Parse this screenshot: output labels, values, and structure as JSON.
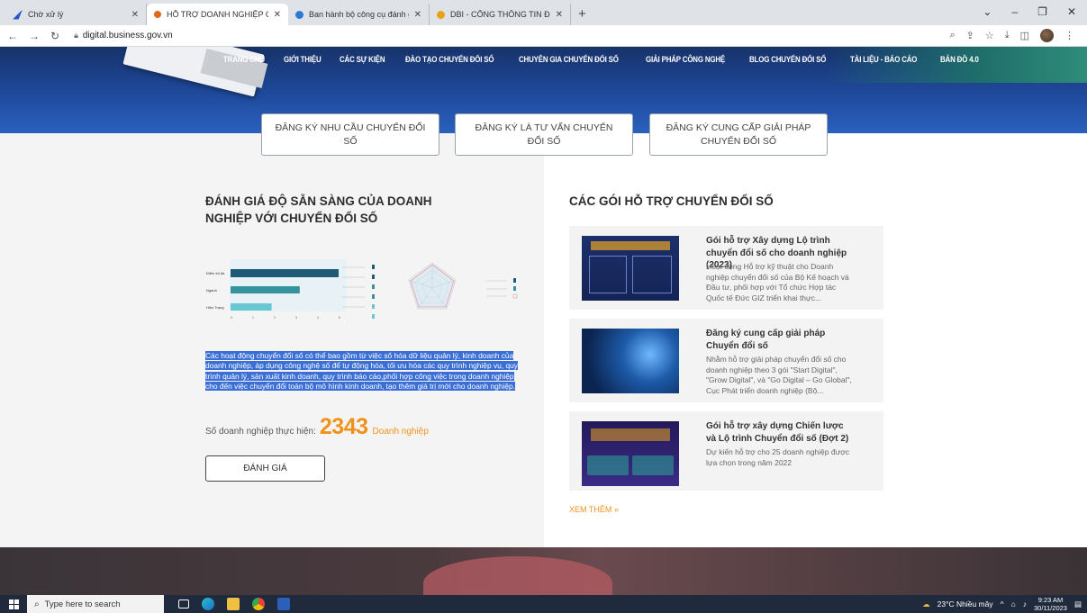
{
  "browser": {
    "tabs": [
      {
        "title": "Chờ xử lý",
        "favicon_color": "#2b57c7",
        "active": false
      },
      {
        "title": "HỖ TRỢ DOANH NGHIỆP CHUY",
        "favicon_color": "#e06a1b",
        "active": true
      },
      {
        "title": "Ban hành bộ công cụ đánh giá",
        "favicon_color": "#2b7bd6",
        "active": false
      },
      {
        "title": "DBI - CỔNG THÔNG TIN ĐÁNH",
        "favicon_color": "#e8a21a",
        "active": false
      }
    ],
    "url": "digital.business.gov.vn"
  },
  "site": {
    "nav": [
      "TRANG CHỦ",
      "GIỚI THIỆU",
      "CÁC SỰ KIỆN",
      "ĐÀO TẠO CHUYỂN ĐỔI SỐ",
      "CHUYÊN GIA CHUYỂN ĐỔI SỐ",
      "GIẢI PHÁP CÔNG NGHỆ",
      "BLOG CHUYỂN ĐỔI SỐ",
      "TÀI LIỆU - BÁO CÁO",
      "BẢN ĐỒ 4.0"
    ],
    "register_buttons": [
      "ĐĂNG KÝ NHU CẦU CHUYỂN ĐỔI SỐ",
      "ĐĂNG KÝ LÀ TƯ VẤN CHUYỂN ĐỔI SỐ",
      "ĐĂNG KÝ CUNG CẤP GIẢI PHÁP CHUYỂN ĐỔI SỐ"
    ],
    "assessment": {
      "title": "ĐÁNH GIÁ ĐỘ SẴN SÀNG CỦA DOANH NGHIỆP VỚI CHUYỂN ĐỔI SỐ",
      "bar_labels": [
        "Điểm tối đa",
        "Ngành",
        "Hiện Trạng"
      ],
      "bar_values": [
        5,
        3.2,
        1.9
      ],
      "axis_ticks": [
        "0",
        "1",
        "2",
        "3",
        "4",
        "5"
      ],
      "description": "Các hoạt động chuyển đổi số có thể bao gồm từ việc số hóa dữ liệu quản lý, kinh doanh của doanh nghiệp, áp dụng công nghệ số để tự động hóa, tối ưu hóa các quy trình nghiệp vụ, quy trình quản lý, sản xuất kinh doanh, quy trình báo cáo,phối hợp công việc trong doanh nghiệp cho đến việc chuyển đổi toàn bộ mô hình kinh doanh, tạo thêm giá trị mới cho doanh nghiệp.",
      "count_label": "Số doanh nghiệp thực hiện:",
      "count_value": "2343",
      "count_unit": "Doanh nghiệp",
      "button_label": "ĐÁNH GIÁ"
    },
    "packages": {
      "title": "CÁC GÓI HỖ TRỢ CHUYỂN ĐỔI SỐ",
      "items": [
        {
          "title": "Gói hỗ trợ Xây dựng Lộ trình chuyển đổi số cho doanh nghiệp (2023)",
          "description": "Hoạt động Hỗ trợ kỹ thuật cho Doanh nghiệp chuyển đổi số của Bộ Kế hoạch và Đầu tư, phối hợp với Tổ chức Hợp tác Quốc tế Đức GIZ triển khai thực..."
        },
        {
          "title": "Đăng ký cung cấp giải pháp Chuyển đổi số",
          "description": "Nhằm hỗ trợ giải pháp chuyển đổi số cho doanh nghiệp theo 3 gói \"Start Digital\", \"Grow Digital\", và \"Go Digital – Go Global\", Cục Phát triển doanh nghiệp (Bộ..."
        },
        {
          "title": "Gói hỗ trợ xây dựng Chiến lược và Lộ trình Chuyển đổi số (Đợt 2)",
          "description": "Dự kiến hỗ trợ cho 25 doanh nghiệp được lựa chọn trong năm 2022"
        }
      ],
      "more": "XEM THÊM »"
    }
  },
  "taskbar": {
    "search_placeholder": "Type here to search",
    "weather": "23°C  Nhiều mây",
    "time": "9:23 AM",
    "date": "30/11/2023"
  }
}
